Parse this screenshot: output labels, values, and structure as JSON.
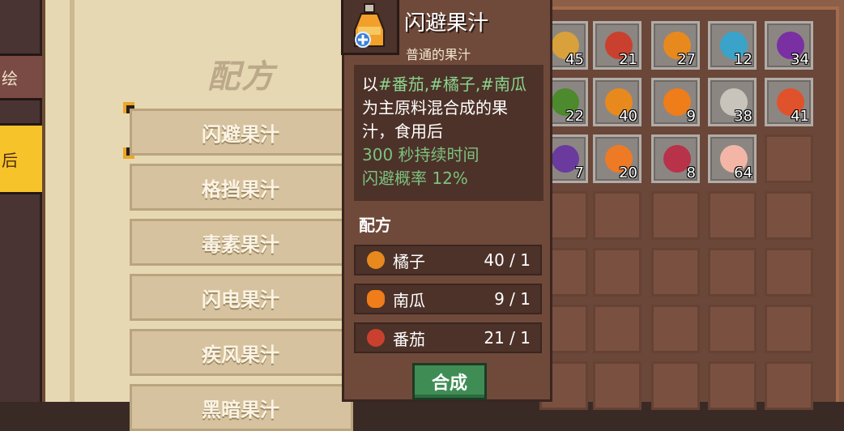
{
  "side_tabs": {
    "tab_a": "绘",
    "tab_b": "后"
  },
  "book": {
    "title": "配方",
    "recipes": [
      {
        "label": "闪避果汁",
        "selected": true
      },
      {
        "label": "格挡果汁",
        "selected": false
      },
      {
        "label": "毒素果汁",
        "selected": false
      },
      {
        "label": "闪电果汁",
        "selected": false
      },
      {
        "label": "疾风果汁",
        "selected": false
      },
      {
        "label": "黑暗果汁",
        "selected": false
      }
    ]
  },
  "tooltip": {
    "title": "闪避果汁",
    "subtitle": "普通的果汁",
    "desc_line1_prefix": "以",
    "desc_line1_tags": "#番茄,#橘子,#南瓜",
    "desc_line2": "为主原料混合成的果",
    "desc_line3": "汁，食用后",
    "desc_effect1": "300 秒持续时间",
    "desc_effect2": "闪避概率 12%",
    "section_title": "配方",
    "ingredients": [
      {
        "icon": "orange-icon",
        "name": "橘子",
        "qty": "40 / 1",
        "color": "#e8891e"
      },
      {
        "icon": "pumpkin-icon",
        "name": "南瓜",
        "qty": "9 / 1",
        "color": "#ee7d1a"
      },
      {
        "icon": "tomato-icon",
        "name": "番茄",
        "qty": "21 / 1",
        "color": "#c9412e"
      }
    ],
    "craft_label": "合成"
  },
  "inventory": {
    "rows": [
      [
        {
          "icon": "wheat-icon",
          "count": "45",
          "color": "#d9a13b"
        },
        {
          "icon": "tomato-icon",
          "count": "21",
          "color": "#c9412e"
        },
        {
          "icon": "orange-icon",
          "count": "27",
          "color": "#e8891e"
        },
        {
          "icon": "blue-mushroom-icon",
          "count": "12",
          "color": "#3aa3c9"
        },
        {
          "icon": "eggplant-icon",
          "count": "34",
          "color": "#7a2fa3"
        }
      ],
      [
        {
          "icon": "pepper-icon",
          "count": "22",
          "color": "#4c8a2d"
        },
        {
          "icon": "orange-icon",
          "count": "40",
          "color": "#e8891e"
        },
        {
          "icon": "pumpkin-icon",
          "count": "9",
          "color": "#ee7d1a"
        },
        {
          "icon": "stone-icon",
          "count": "38",
          "color": "#c9c4bb"
        },
        {
          "icon": "fire-flower-icon",
          "count": "41",
          "color": "#e0522b"
        }
      ],
      [
        {
          "icon": "grape-icon",
          "count": "7",
          "color": "#6b3a9e"
        },
        {
          "icon": "carrot-icon",
          "count": "20",
          "color": "#ef7a26"
        },
        {
          "icon": "berry-icon",
          "count": "8",
          "color": "#b8324a"
        },
        {
          "icon": "peach-icon",
          "count": "64",
          "color": "#f3b6a6"
        },
        {
          "icon": "",
          "count": "",
          "color": ""
        }
      ]
    ]
  }
}
